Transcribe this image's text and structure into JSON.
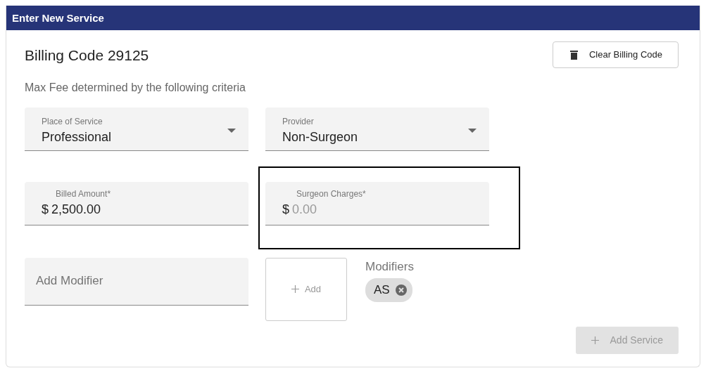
{
  "header": {
    "title": "Enter New Service"
  },
  "billing_code": {
    "heading": "Billing Code 29125",
    "clear_button": "Clear Billing Code"
  },
  "criteria_text": "Max Fee determined by the following criteria",
  "selects": [
    {
      "label": "Place of Service",
      "value": "Professional"
    },
    {
      "label": "Provider",
      "value": "Non-Surgeon"
    }
  ],
  "amounts": [
    {
      "label": "Billed Amount*",
      "prefix": "$",
      "value": "2,500.00",
      "highlighted": false
    },
    {
      "label": "Surgeon Charges*",
      "prefix": "$",
      "placeholder": "0.00",
      "highlighted": true
    }
  ],
  "modifier_input": {
    "placeholder": "Add Modifier"
  },
  "add_button": {
    "label": "Add"
  },
  "modifiers": {
    "label": "Modifiers",
    "chips": [
      {
        "label": "AS"
      }
    ]
  },
  "add_service_button": {
    "label": "Add Service",
    "disabled": true
  }
}
